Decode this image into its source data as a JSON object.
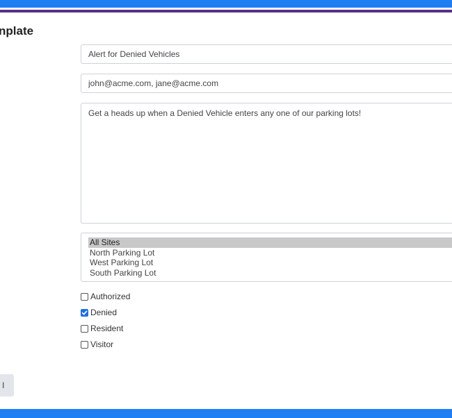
{
  "header": {
    "title": "nplate"
  },
  "form": {
    "name_value": "Alert for Denied Vehicles",
    "emails_value": "john@acme.com, jane@acme.com",
    "message_value": "Get a heads up when a Denied Vehicle enters any one of our parking lots!",
    "sites": [
      {
        "label": "All Sites",
        "selected": true
      },
      {
        "label": "North Parking Lot",
        "selected": false
      },
      {
        "label": "West Parking Lot",
        "selected": false
      },
      {
        "label": "South Parking Lot",
        "selected": false
      }
    ],
    "statuses": [
      {
        "label": "Authorized",
        "checked": false
      },
      {
        "label": "Denied",
        "checked": true
      },
      {
        "label": "Resident",
        "checked": false
      },
      {
        "label": "Visitor",
        "checked": false
      }
    ],
    "submit_label": "l"
  },
  "colors": {
    "top_bar": "#1f7ef2",
    "accent_bar": "#5b2e86",
    "bottom_bar": "#1f7ef2",
    "checkbox_checked": "#1f6fde"
  },
  "icons": {
    "checkmark": "check-icon"
  }
}
